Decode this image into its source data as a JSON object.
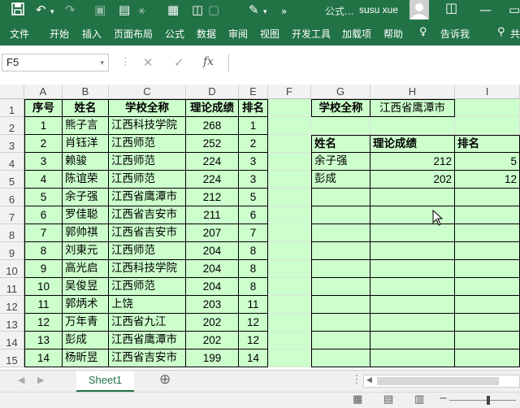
{
  "colors": {
    "ribbon": "#217346",
    "cell_fill": "#ccffcc"
  },
  "title_bar": {
    "filename": "公式...",
    "user": "susu xue",
    "more": "»"
  },
  "ribbon": {
    "tabs": [
      "文件",
      "开始",
      "插入",
      "页面布局",
      "公式",
      "数据",
      "审阅",
      "视图",
      "开发工具",
      "加载项",
      "帮助",
      "告诉我",
      "共"
    ]
  },
  "formula_bar": {
    "name_box": "F5",
    "fx": "fx",
    "cancel": "✕",
    "confirm": "✓",
    "dropdown": "▾"
  },
  "columns": [
    "A",
    "B",
    "C",
    "D",
    "E",
    "F",
    "G",
    "H",
    "I"
  ],
  "rows": [
    "1",
    "2",
    "3",
    "4",
    "5",
    "6",
    "7",
    "8",
    "9",
    "10",
    "11",
    "12",
    "13",
    "14",
    "15"
  ],
  "table": {
    "headers": [
      "序号",
      "姓名",
      "学校全称",
      "理论成绩",
      "排名"
    ],
    "rows": [
      [
        "1",
        "熊子言",
        "江西科技学院",
        "268",
        "1"
      ],
      [
        "2",
        "肖钰洋",
        "江西师范",
        "252",
        "2"
      ],
      [
        "3",
        "赖骏",
        "江西师范",
        "224",
        "3"
      ],
      [
        "4",
        "陈谊荣",
        "江西师范",
        "224",
        "3"
      ],
      [
        "5",
        "余子强",
        "江西省鹰潭市",
        "212",
        "5"
      ],
      [
        "6",
        "罗佳聪",
        "江西省吉安市",
        "211",
        "6"
      ],
      [
        "7",
        "郭帅祺",
        "江西省吉安市",
        "207",
        "7"
      ],
      [
        "8",
        "刘東元",
        "江西师范",
        "204",
        "8"
      ],
      [
        "9",
        "高光启",
        "江西科技学院",
        "204",
        "8"
      ],
      [
        "10",
        "吴俊昱",
        "江西师范",
        "204",
        "8"
      ],
      [
        "11",
        "郭炳术",
        "上饶",
        "203",
        "11"
      ],
      [
        "12",
        "万年青",
        "江西省九江",
        "202",
        "12"
      ],
      [
        "13",
        "彭成",
        "江西省鹰潭市",
        "202",
        "12"
      ],
      [
        "14",
        "杨昕昱",
        "江西省吉安市",
        "199",
        "14"
      ]
    ]
  },
  "criteria": {
    "label": "学校全称",
    "value": "江西省鹰潭市"
  },
  "result": {
    "headers": [
      "姓名",
      "理论成绩",
      "排名"
    ],
    "rows": [
      [
        "余子强",
        "212",
        "5"
      ],
      [
        "彭成",
        "202",
        "12"
      ]
    ]
  },
  "sheet_tabs": [
    "Sheet1"
  ],
  "add_sheet": "⊕"
}
